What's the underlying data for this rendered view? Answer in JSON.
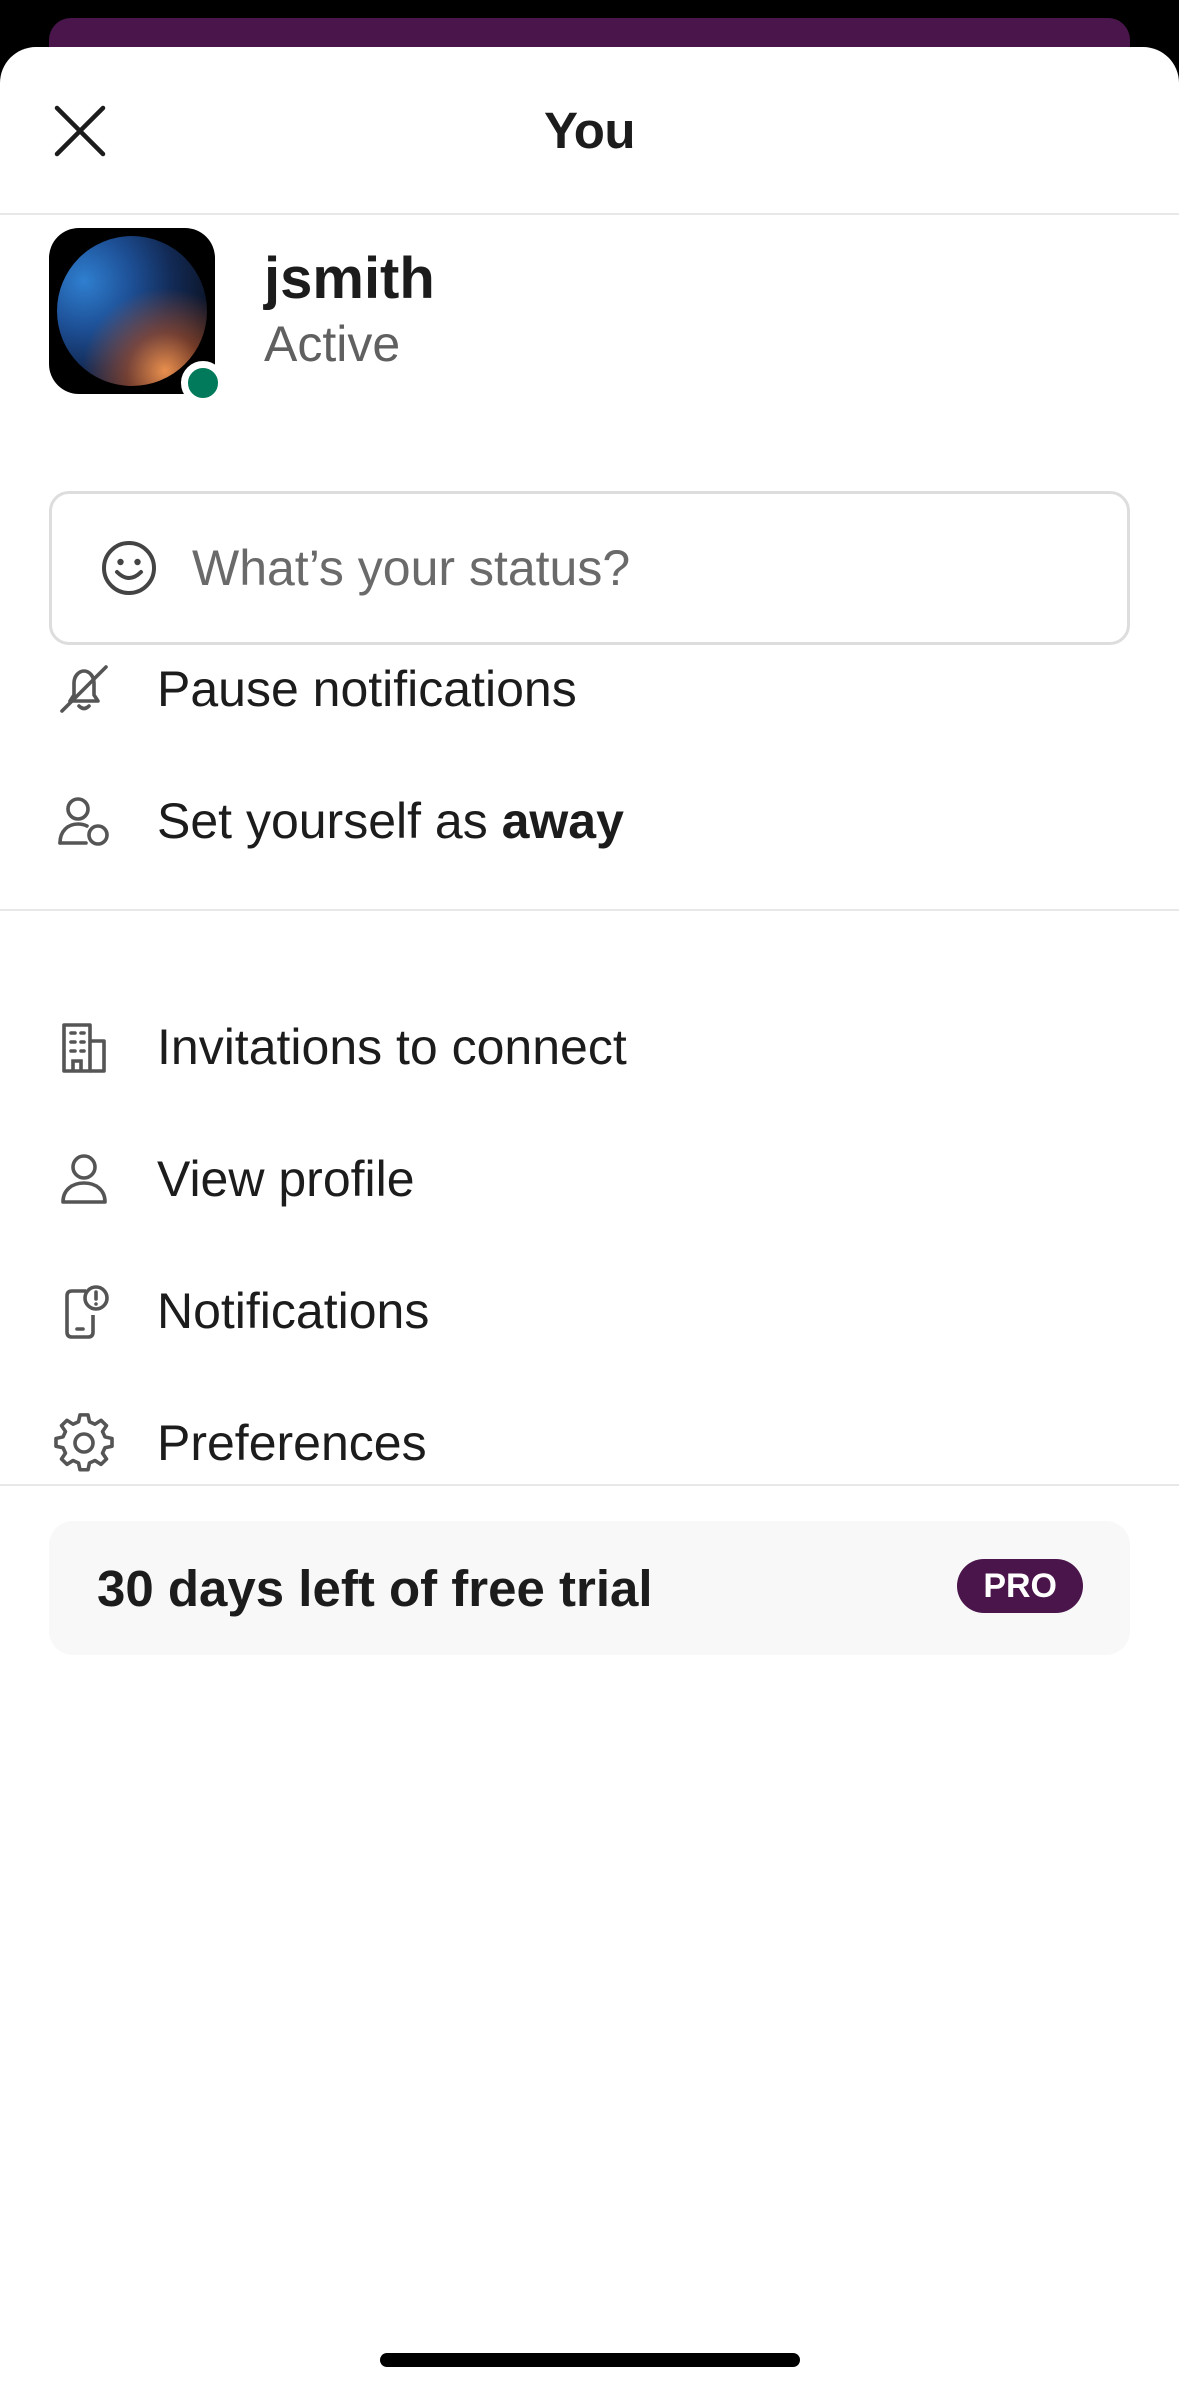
{
  "header": {
    "title": "You",
    "close_icon": "close-icon"
  },
  "profile": {
    "username": "jsmith",
    "presence": "Active",
    "presence_color": "#007a5a"
  },
  "status": {
    "placeholder": "What’s your status?",
    "icon": "smiley-icon"
  },
  "menu_primary": [
    {
      "label": "Pause notifications",
      "icon": "bell-off-icon"
    },
    {
      "label_prefix": "Set yourself as ",
      "label_bold": "away",
      "icon": "person-away-icon"
    }
  ],
  "menu_secondary": [
    {
      "label": "Invitations to connect",
      "icon": "building-icon"
    },
    {
      "label": "View profile",
      "icon": "person-icon"
    },
    {
      "label": "Notifications",
      "icon": "phone-notification-icon"
    },
    {
      "label": "Preferences",
      "icon": "gear-icon"
    }
  ],
  "trial": {
    "text": "30 days left of free trial",
    "badge": "PRO"
  },
  "colors": {
    "brand": "#4a154b",
    "divider": "#e8e8e8",
    "text": "#1d1c1d",
    "muted": "#616061"
  }
}
